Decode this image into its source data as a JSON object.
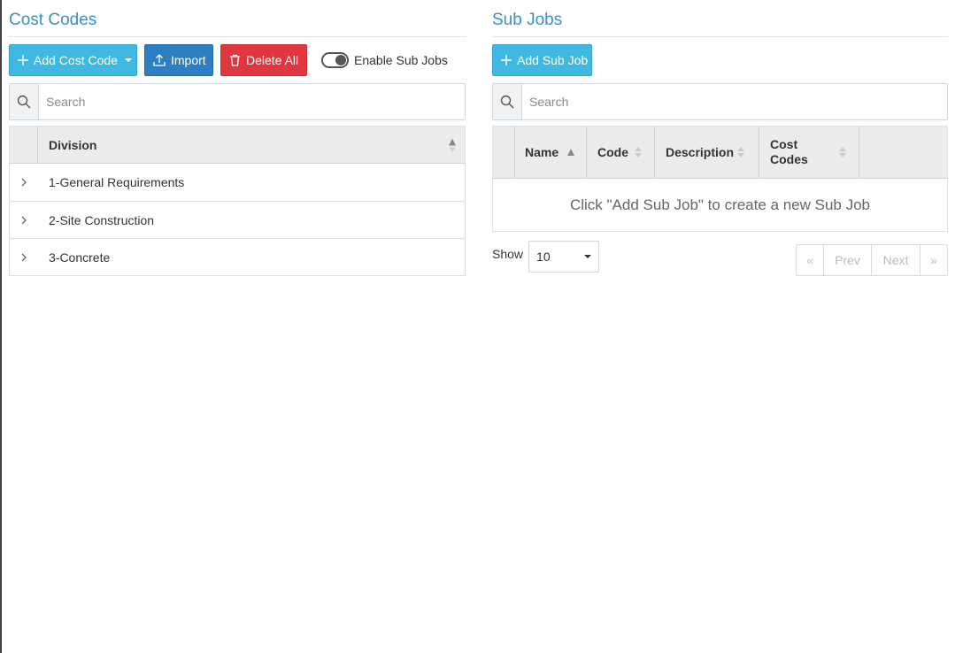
{
  "cost_codes": {
    "title": "Cost Codes",
    "add_button_label": "Add Cost Code",
    "import_button_label": "Import",
    "delete_all_button_label": "Delete All",
    "toggle_label": "Enable Sub Jobs",
    "toggle_on": true,
    "search_placeholder": "Search",
    "table": {
      "column_header": "Division",
      "rows": [
        {
          "label": "1-General Requirements"
        },
        {
          "label": "2-Site Construction"
        },
        {
          "label": "3-Concrete"
        }
      ]
    }
  },
  "sub_jobs": {
    "title": "Sub Jobs",
    "add_button_label": "Add Sub Job",
    "search_placeholder": "Search",
    "table": {
      "columns": {
        "name": "Name",
        "code": "Code",
        "description": "Description",
        "cost_codes_line1": "Cost",
        "cost_codes_line2": "Codes"
      },
      "empty_message": "Click \"Add Sub Job\" to create a new Sub Job"
    },
    "footer": {
      "show_label": "Show",
      "page_size": "10",
      "pager": {
        "first": "«",
        "prev": "Prev",
        "next": "Next",
        "last": "»"
      }
    }
  },
  "colors": {
    "title": "#3a8fc9",
    "info_button": "#3fb8e2",
    "primary_button": "#2b7fc2",
    "danger_button": "#e0363f"
  }
}
